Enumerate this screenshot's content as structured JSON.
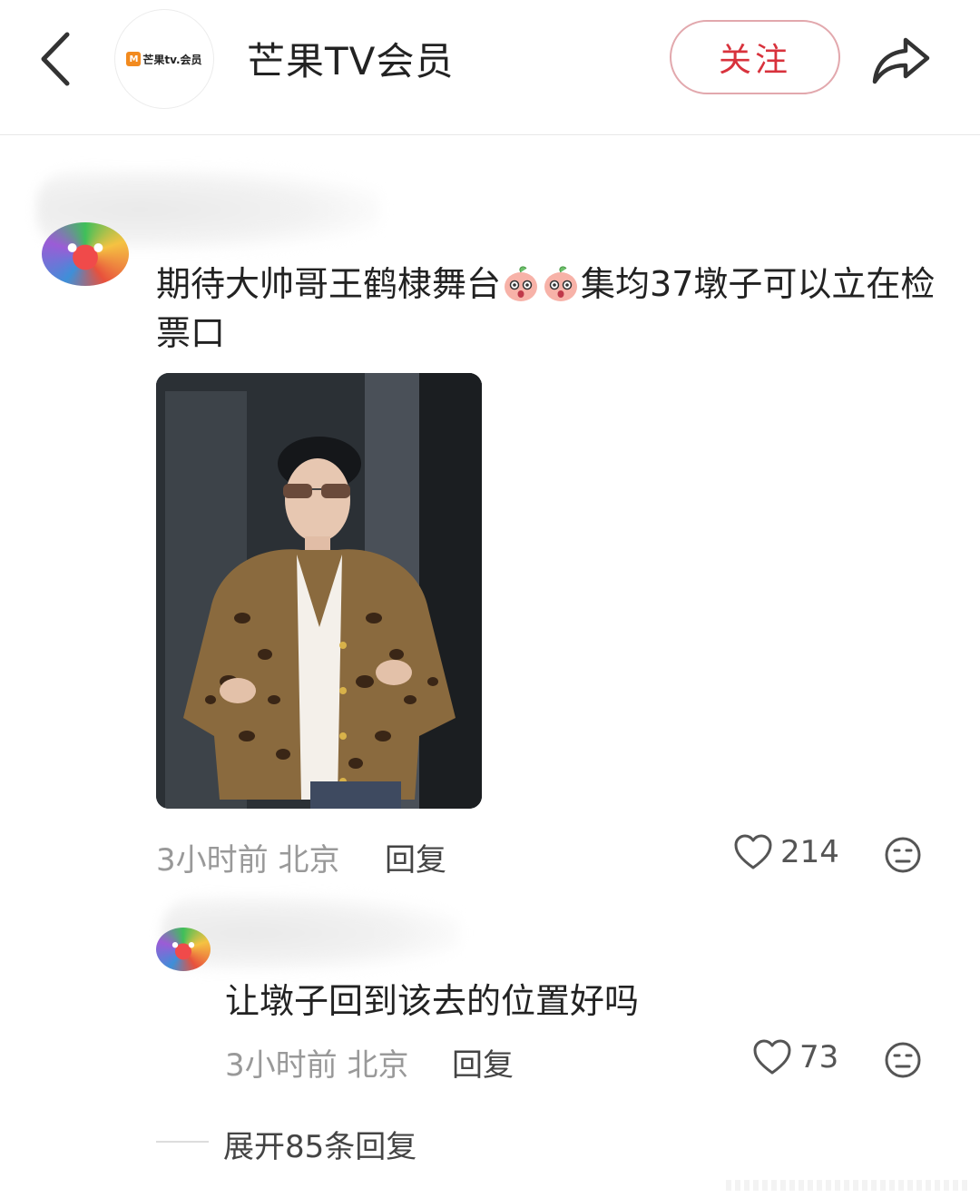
{
  "header": {
    "account_name": "芒果TV会员",
    "logo_text": "芒果tv.会员",
    "logo_mark": "M",
    "follow_label": "关注"
  },
  "comment": {
    "text_before": "期待大帅哥王鹤棣舞台",
    "text_after": "集均37墩子可以立在检票口",
    "time": "3小时前",
    "location": "北京",
    "reply_label": "回复",
    "likes": "214"
  },
  "reply": {
    "text": "让墩子回到该去的位置好吗",
    "time": "3小时前",
    "location": "北京",
    "reply_label": "回复",
    "likes": "73"
  },
  "expand": {
    "label": "展开85条回复"
  },
  "colors": {
    "accent": "#d8323c",
    "follow_border": "#e2a8ad",
    "muted": "#999999"
  },
  "icons": [
    "back-arrow-icon",
    "share-icon",
    "heart-icon",
    "dislike-face-icon",
    "peach-emoji-icon"
  ]
}
